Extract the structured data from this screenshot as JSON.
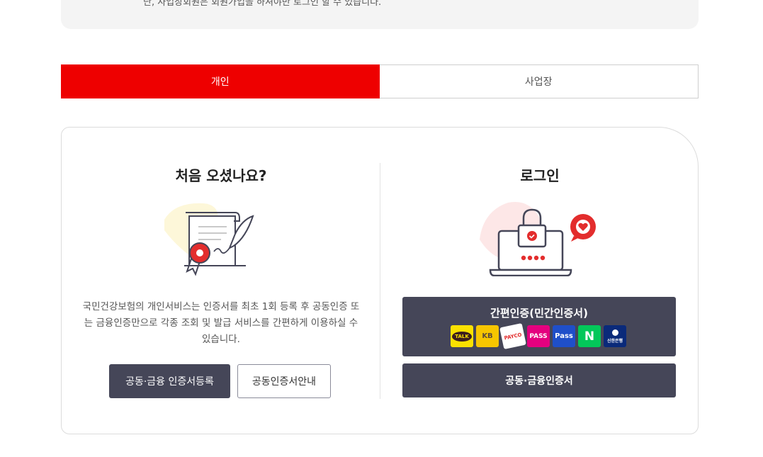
{
  "notice": {
    "text": "단, 사업장회원은 회원가입을 하셔야만 로그인 할 수 있습니다."
  },
  "tabs": [
    {
      "label": "개인",
      "active": true
    },
    {
      "label": "사업장",
      "active": false
    }
  ],
  "left": {
    "heading": "처음 오셨나요?",
    "description": "국민건강보험의 개인서비스는 인증서를 최초 1회 등록 후 공동인증 또는 금융인증만으로 각종 조회 및 발급 서비스를 간편하게 이용하실 수 있습니다.",
    "register_button": "공동·금융 인증서등록",
    "guide_button": "공동인증서안내"
  },
  "right": {
    "heading": "로그인",
    "simple_auth_label": "간편인증(민간인증서)",
    "providers": [
      {
        "name": "kakaotalk",
        "label": "TALK",
        "color": "#fae100"
      },
      {
        "name": "kb",
        "label": "KB",
        "color": "#f7c600"
      },
      {
        "name": "payco",
        "label": "PAYCO",
        "color": "#ffffff"
      },
      {
        "name": "pass",
        "label": "PASS",
        "color": "#e4007f"
      },
      {
        "name": "samsung-pass",
        "label": "Pass",
        "color": "#1f4fc9"
      },
      {
        "name": "naver",
        "label": "N",
        "color": "#03c75a"
      },
      {
        "name": "shinhan",
        "label": "신한은행",
        "color": "#0a2a7a"
      }
    ],
    "cert_button": "공동·금융인증서"
  },
  "colors": {
    "accent": "#ee0000",
    "button_dark": "#454658"
  }
}
